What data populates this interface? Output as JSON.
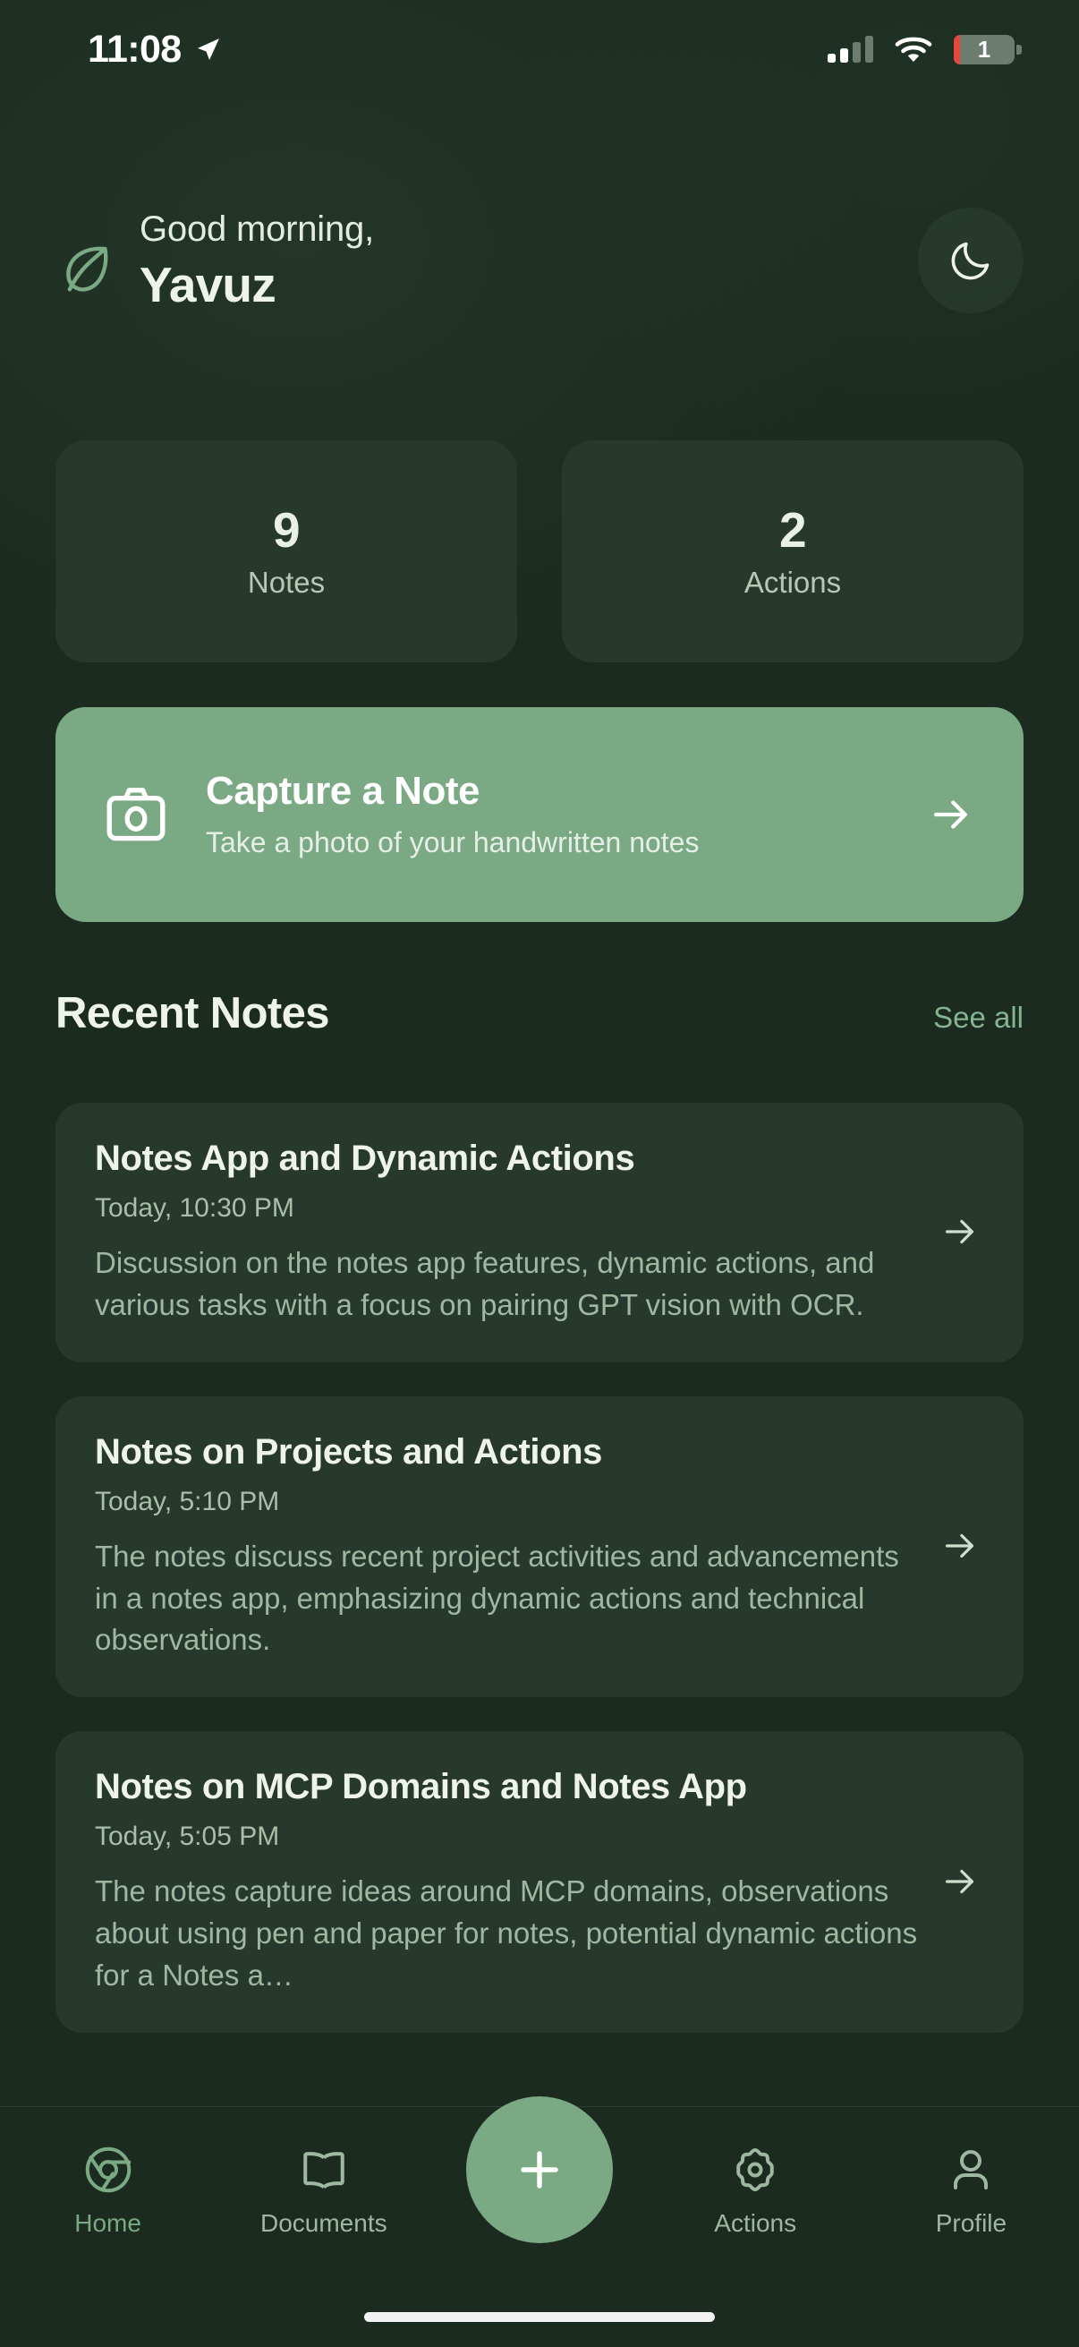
{
  "status_bar": {
    "time": "11:08",
    "location_icon": "location-arrow-icon",
    "signal_icon": "cellular-signal-icon",
    "wifi_icon": "wifi-icon",
    "battery_level": "1",
    "battery_icon": "battery-icon"
  },
  "header": {
    "leaf_icon": "leaf-icon",
    "greeting": "Good morning,",
    "name": "Yavuz",
    "theme_toggle_icon": "moon-icon"
  },
  "stats": [
    {
      "value": "9",
      "label": "Notes"
    },
    {
      "value": "2",
      "label": "Actions"
    }
  ],
  "capture": {
    "icon": "camera-icon",
    "title": "Capture a Note",
    "subtitle": "Take a photo of your handwritten notes",
    "arrow_icon": "arrow-right-icon"
  },
  "recent": {
    "title": "Recent Notes",
    "see_all": "See all"
  },
  "notes": [
    {
      "title": "Notes App and Dynamic Actions",
      "time": "Today, 10:30 PM",
      "snippet": "Discussion on the notes app features, dynamic actions, and various tasks with a focus on pairing GPT vision with OCR.",
      "arrow_icon": "arrow-right-icon"
    },
    {
      "title": "Notes on Projects and Actions",
      "time": "Today, 5:10 PM",
      "snippet": "The notes discuss recent project activities and advancements in a notes app, emphasizing dynamic actions and technical observations.",
      "arrow_icon": "arrow-right-icon"
    },
    {
      "title": "Notes on MCP Domains and Notes App",
      "time": "Today, 5:05 PM",
      "snippet": "The notes capture ideas around MCP domains, observations about using pen and paper for notes, potential dynamic actions for a Notes a…",
      "arrow_icon": "arrow-right-icon"
    }
  ],
  "nav": {
    "items": [
      {
        "label": "Home",
        "icon": "chrome-circle-icon",
        "active": true
      },
      {
        "label": "Documents",
        "icon": "book-open-icon",
        "active": false
      },
      {
        "label": "Actions",
        "icon": "gear-icon",
        "active": false
      },
      {
        "label": "Profile",
        "icon": "person-icon",
        "active": false
      }
    ],
    "fab_icon": "plus-icon"
  },
  "colors": {
    "background": "#1b2b20",
    "surface": "#27382c",
    "accent": "#7aa984",
    "text_primary": "#eef4ec",
    "text_secondary": "#9fb8a2",
    "battery_low": "#e8483c"
  }
}
